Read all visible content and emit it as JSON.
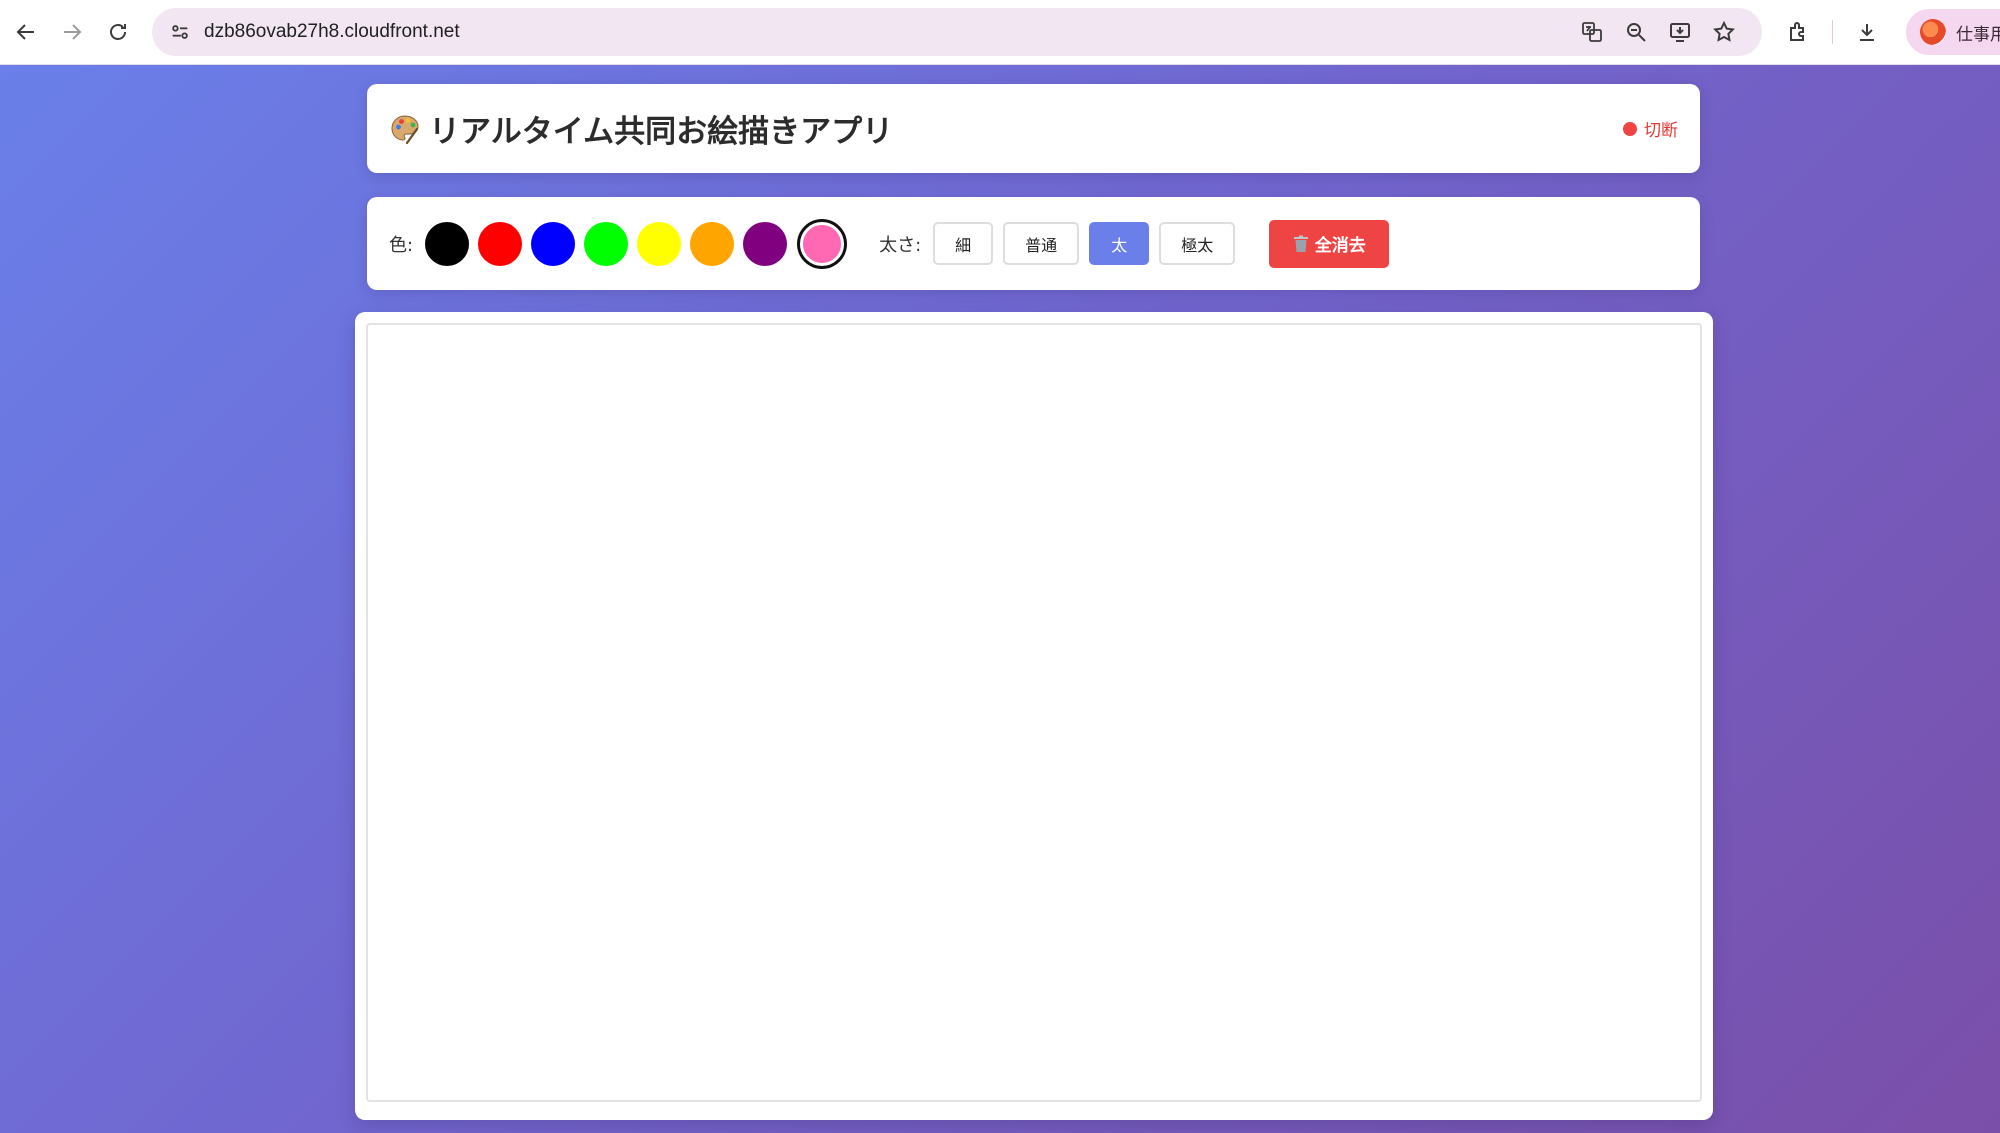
{
  "browser": {
    "url": "dzb86ovab27h8.cloudfront.net",
    "profile_name": "仕事用"
  },
  "header": {
    "title": "リアルタイム共同お絵描きアプリ",
    "status_text": "切断",
    "status_color": "#f04444"
  },
  "toolbar": {
    "color_label": "色:",
    "colors": [
      "#000000",
      "#ff0000",
      "#0000ff",
      "#00ff00",
      "#ffff00",
      "#ffa500",
      "#800080",
      "#ff69b4"
    ],
    "selected_color": "#ff69b4",
    "size_label": "太さ:",
    "sizes": [
      "細",
      "普通",
      "太",
      "極太"
    ],
    "active_size": "太",
    "clear_label": "全消去"
  },
  "colors": {
    "accent": "#6a7fe9",
    "danger": "#ef4444"
  }
}
